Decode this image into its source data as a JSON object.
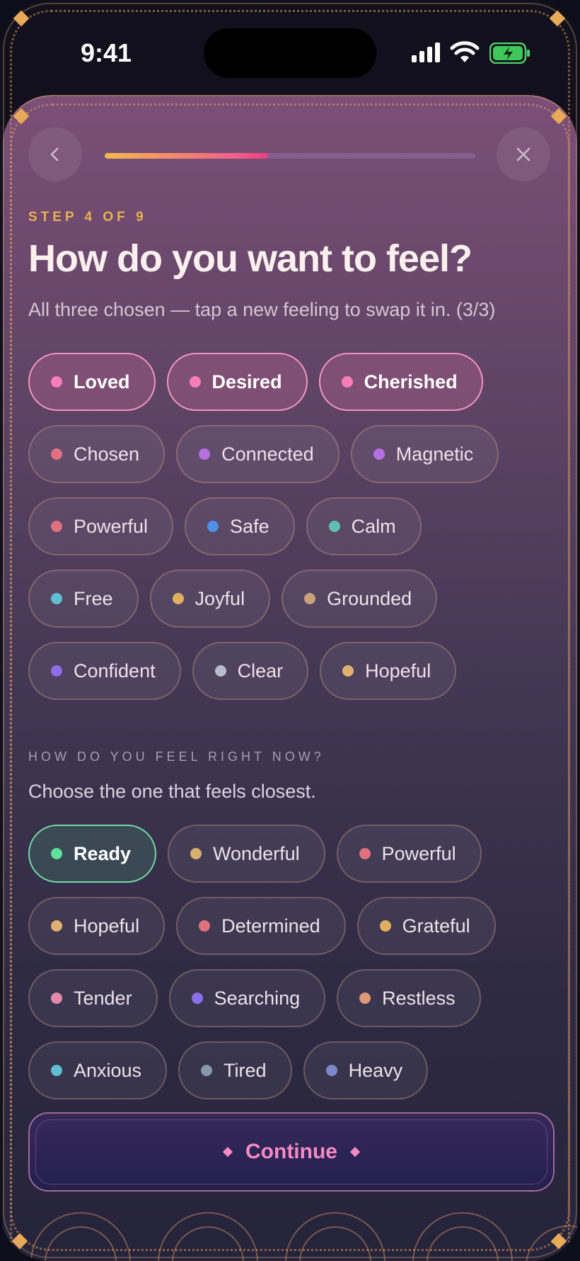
{
  "status_bar": {
    "time": "9:41"
  },
  "header": {
    "progress": 0.44
  },
  "step": {
    "label": "STEP 4 OF 9"
  },
  "question": {
    "title": "How do you want to feel?",
    "subtitle": "All three chosen — tap a new feeling to swap it in. (3/3)"
  },
  "desired_feelings": [
    {
      "label": "Loved",
      "selected": true,
      "dot_color": "#f77fb8"
    },
    {
      "label": "Desired",
      "selected": true,
      "dot_color": "#f77fb8"
    },
    {
      "label": "Cherished",
      "selected": true,
      "dot_color": "#f77fb8"
    },
    {
      "label": "Chosen",
      "selected": false,
      "dot_color": "#e0707f"
    },
    {
      "label": "Connected",
      "selected": false,
      "dot_color": "#b470e0"
    },
    {
      "label": "Magnetic",
      "selected": false,
      "dot_color": "#b470e0"
    },
    {
      "label": "Powerful",
      "selected": false,
      "dot_color": "#e0707f"
    },
    {
      "label": "Safe",
      "selected": false,
      "dot_color": "#4f8fe8"
    },
    {
      "label": "Calm",
      "selected": false,
      "dot_color": "#5fc0b0"
    },
    {
      "label": "Free",
      "selected": false,
      "dot_color": "#5cc0d0"
    },
    {
      "label": "Joyful",
      "selected": false,
      "dot_color": "#e0b060"
    },
    {
      "label": "Grounded",
      "selected": false,
      "dot_color": "#c8a07a"
    },
    {
      "label": "Confident",
      "selected": false,
      "dot_color": "#8c6ee8"
    },
    {
      "label": "Clear",
      "selected": false,
      "dot_color": "#b8bccc"
    },
    {
      "label": "Hopeful",
      "selected": false,
      "dot_color": "#e0b070"
    }
  ],
  "current_section": {
    "label": "HOW DO YOU FEEL RIGHT NOW?",
    "subtitle": "Choose the one that feels closest."
  },
  "current_feelings": [
    {
      "label": "Ready",
      "selected": true,
      "dot_color": "#5fe09c"
    },
    {
      "label": "Wonderful",
      "selected": false,
      "dot_color": "#d8b070"
    },
    {
      "label": "Powerful",
      "selected": false,
      "dot_color": "#e0707f"
    },
    {
      "label": "Hopeful",
      "selected": false,
      "dot_color": "#e0b070"
    },
    {
      "label": "Determined",
      "selected": false,
      "dot_color": "#e0707f"
    },
    {
      "label": "Grateful",
      "selected": false,
      "dot_color": "#e0b060"
    },
    {
      "label": "Tender",
      "selected": false,
      "dot_color": "#e08aa8"
    },
    {
      "label": "Searching",
      "selected": false,
      "dot_color": "#8c6ee8"
    },
    {
      "label": "Restless",
      "selected": false,
      "dot_color": "#e09a78"
    },
    {
      "label": "Anxious",
      "selected": false,
      "dot_color": "#5cc0d0"
    },
    {
      "label": "Tired",
      "selected": false,
      "dot_color": "#8898b0"
    },
    {
      "label": "Heavy",
      "selected": false,
      "dot_color": "#7c88c8"
    }
  ],
  "footer": {
    "continue_label": "Continue"
  },
  "colors": {
    "accent_pink": "#f294c2",
    "accent_gold": "#e8b250",
    "accent_green": "#72d9a2"
  }
}
